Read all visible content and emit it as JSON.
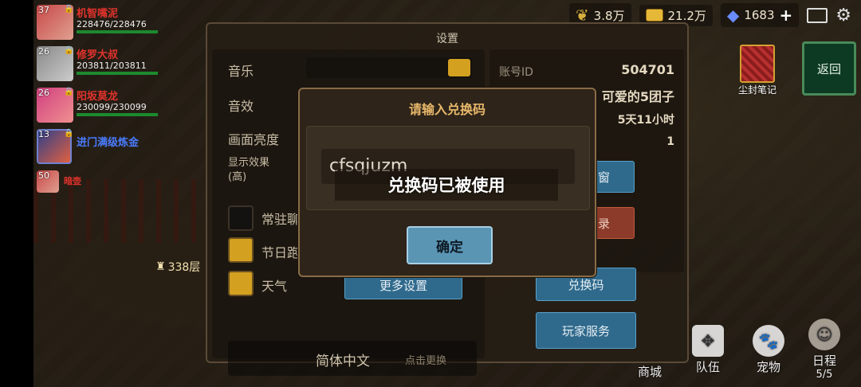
{
  "top": {
    "grain": "3.8万",
    "gold": "21.2万",
    "gems": "1683",
    "plus": "+"
  },
  "heroes": [
    {
      "level": "37",
      "name": "机智嘴泥",
      "hp": "228476/228476",
      "hp_fraction": 1.0
    },
    {
      "level": "26",
      "name": "修罗大叔",
      "hp": "203811/203811",
      "hp_fraction": 1.0
    },
    {
      "level": "26",
      "name": "阳坂莫龙",
      "hp": "230099/230099",
      "hp_fraction": 1.0
    },
    {
      "level": "13",
      "name": "进门满级炼金"
    },
    {
      "level": "50",
      "name": "暗壶"
    }
  ],
  "floor": "338层",
  "settings": {
    "title": "设置",
    "music": "音乐",
    "sfx": "音效",
    "brightness": "画面亮度",
    "display_effect": "显示效果(高)",
    "checks": [
      {
        "label": "常驻聊",
        "checked": false
      },
      {
        "label": "节日跑",
        "checked": true
      },
      {
        "label": "天气",
        "checked": true
      }
    ],
    "more_settings": "更多设置",
    "language": "简体中文",
    "change": "点击更换",
    "account_id_label": "账号ID",
    "account_id": "504701",
    "nickname": "可爱的5团子",
    "time": "5天11小时",
    "count": "1",
    "btn_window": "窗",
    "btn_record": "录",
    "redeem": "兑换码",
    "service": "玩家服务"
  },
  "modal": {
    "title": "请输入兑换码",
    "input_value": "cfsqjuzm",
    "toast": "兑换码已被使用",
    "confirm": "确定"
  },
  "right": {
    "book": "尘封笔记",
    "back": "返回"
  },
  "nav": {
    "shop": "商城",
    "team": "队伍",
    "pet": "宠物",
    "schedule": "日程",
    "schedule_count": "5/5"
  }
}
